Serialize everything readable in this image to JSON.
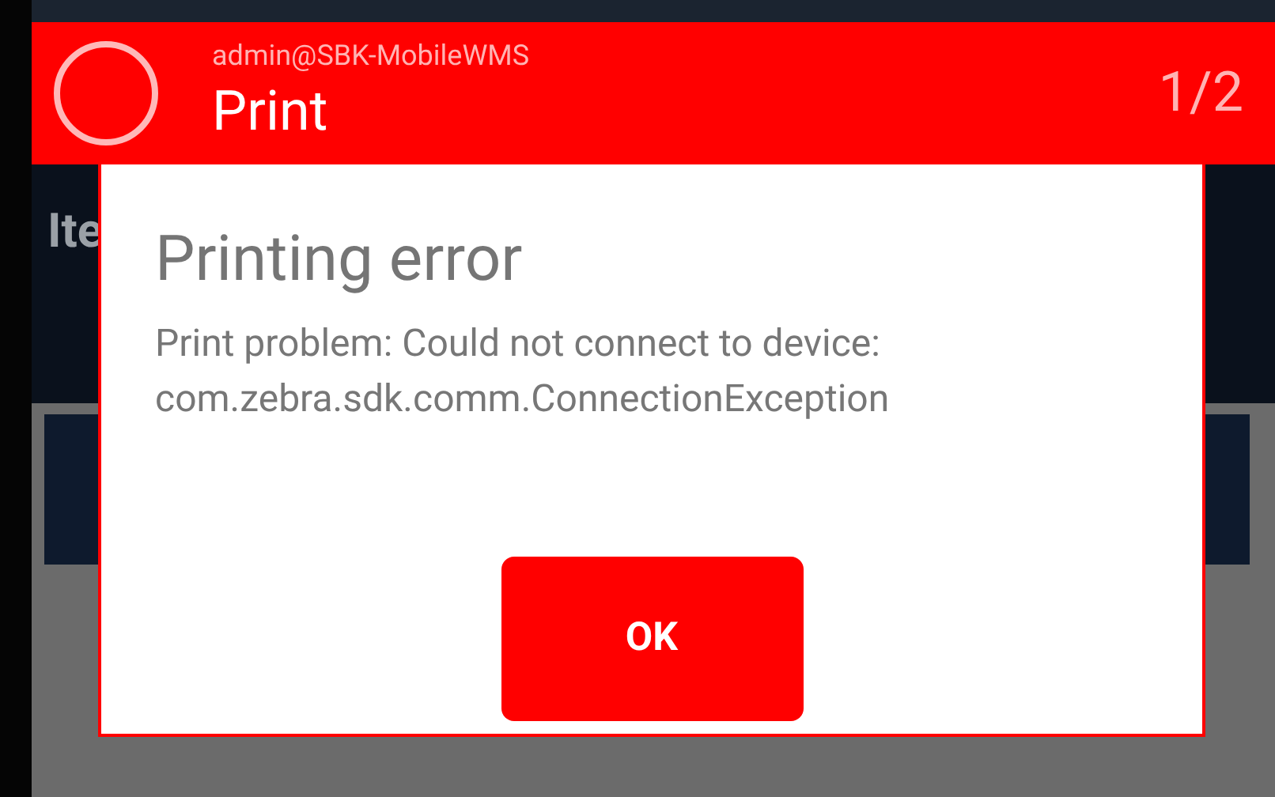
{
  "app_bar": {
    "subtitle": "admin@SBK-MobileWMS",
    "title": "Print",
    "counter": "1/2"
  },
  "background": {
    "heading": "Ite"
  },
  "dialog": {
    "title": "Printing error",
    "message": "Print problem: Could not connect to device: com.zebra.sdk.comm.ConnectionException",
    "buttons": [
      "OK"
    ]
  }
}
